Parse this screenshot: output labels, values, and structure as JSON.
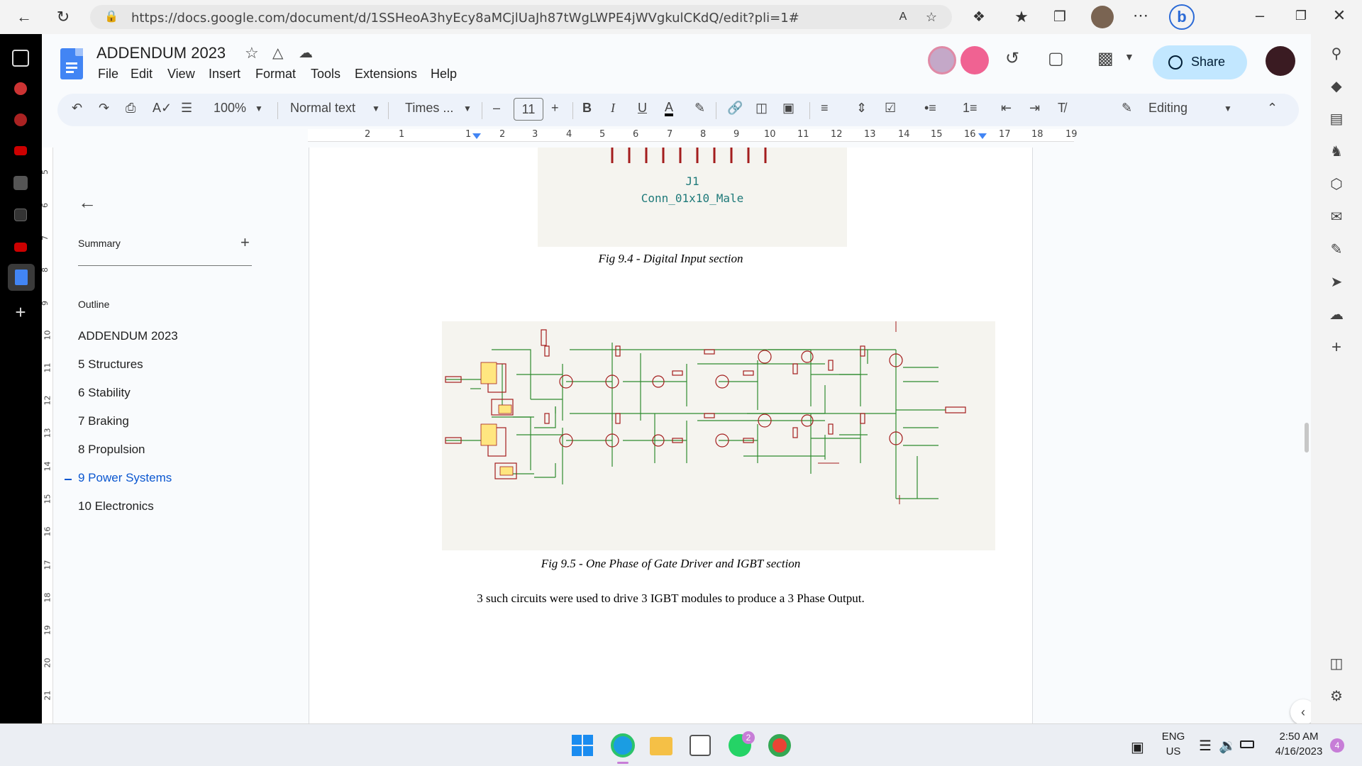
{
  "browser": {
    "url": "https://docs.google.com/document/d/1SSHeoA3hyEcy8aMCjlUaJh87tWgLWPE4jWVgkulCKdQ/edit?pli=1#"
  },
  "header": {
    "title": "ADDENDUM 2023",
    "menu": [
      "File",
      "Edit",
      "View",
      "Insert",
      "Format",
      "Tools",
      "Extensions",
      "Help"
    ],
    "share_label": "Share"
  },
  "toolbar": {
    "zoom": "100%",
    "style": "Normal text",
    "font": "Times ...",
    "font_size": "11",
    "mode": "Editing"
  },
  "ruler": {
    "h_labels": [
      "2",
      "1",
      "1",
      "2",
      "3",
      "4",
      "5",
      "6",
      "7",
      "8",
      "9",
      "10",
      "11",
      "12",
      "13",
      "14",
      "15",
      "16",
      "17",
      "18",
      "19"
    ],
    "v_labels": [
      "5",
      "6",
      "7",
      "8",
      "9",
      "10",
      "11",
      "12",
      "13",
      "14",
      "15",
      "16",
      "17",
      "18",
      "19",
      "20",
      "21"
    ]
  },
  "outline": {
    "summary_label": "Summary",
    "outline_label": "Outline",
    "items": [
      {
        "label": "ADDENDUM 2023",
        "active": false
      },
      {
        "label": "5 Structures",
        "active": false
      },
      {
        "label": "6 Stability",
        "active": false
      },
      {
        "label": "7 Braking",
        "active": false
      },
      {
        "label": "8 Propulsion",
        "active": false
      },
      {
        "label": "9 Power Systems",
        "active": true
      },
      {
        "label": "10 Electronics",
        "active": false
      }
    ]
  },
  "document": {
    "connector_ref": "J1",
    "connector_name": "Conn_01x10_Male",
    "caption_1": "Fig 9.4 - Digital Input section",
    "caption_2": "Fig 9.5 - One Phase of Gate Driver and IGBT section",
    "body_text": "3 such circuits were used to drive 3 IGBT modules to produce a 3 Phase Output."
  },
  "taskbar": {
    "lang_line1": "ENG",
    "lang_line2": "US",
    "time": "2:50 AM",
    "date": "4/16/2023",
    "whatsapp_badge": "2",
    "notification_count": "4"
  },
  "colors": {
    "docs_blue": "#4285f4",
    "share_bg": "#c2e7ff",
    "active_outline": "#0b57d0",
    "schematic_wire": "#2e8b2e",
    "schematic_part": "#a31d1d"
  }
}
